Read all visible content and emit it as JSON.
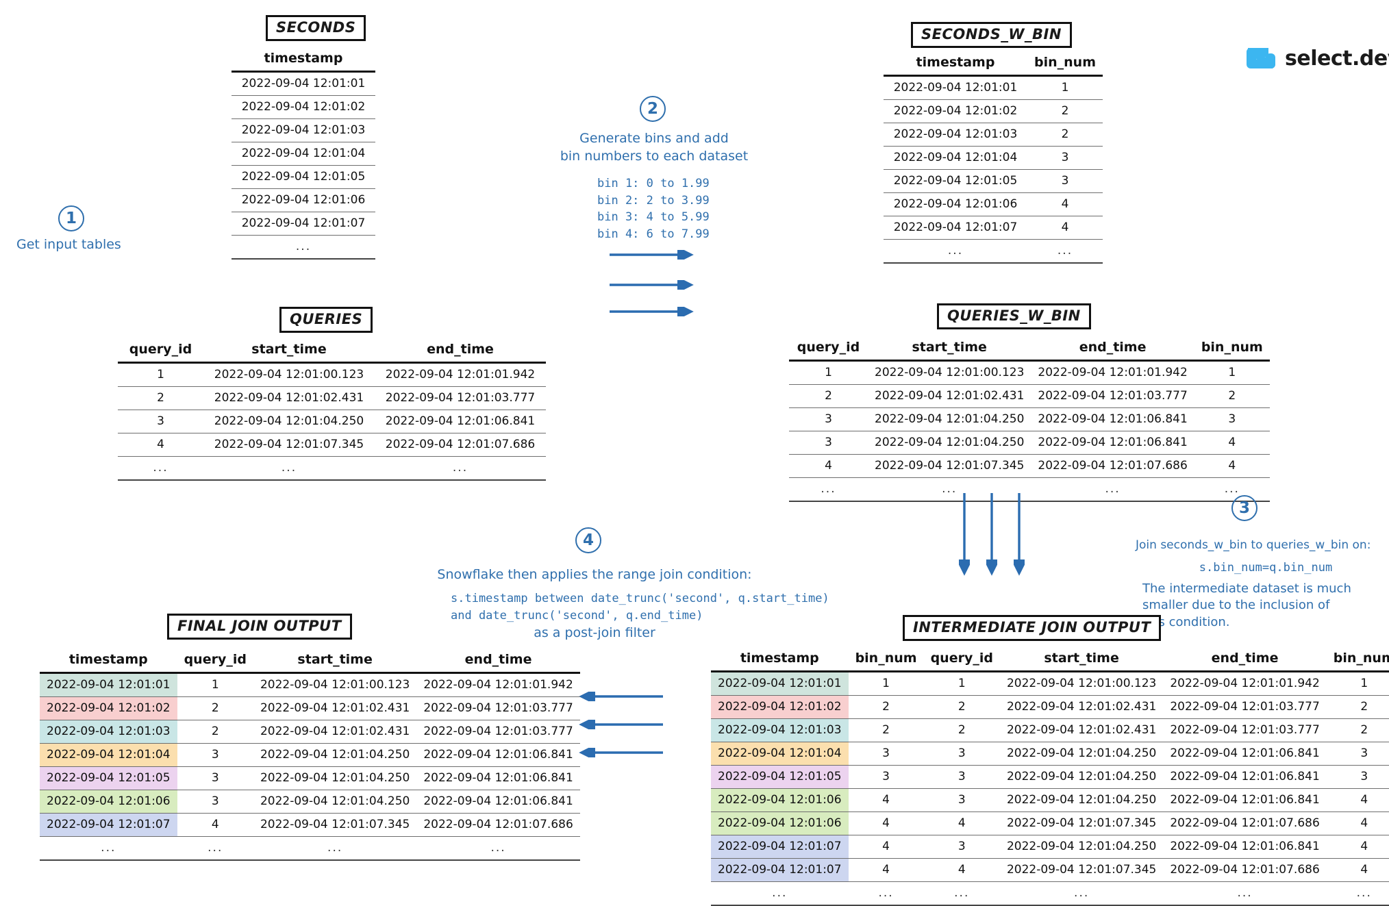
{
  "brand": {
    "name": "select.dev",
    "mark_color": "#3cb6f0",
    "icon": "select-logo-icon"
  },
  "accent_color": "#2f6fad",
  "steps": [
    {
      "number": "1",
      "title": "Get input tables"
    },
    {
      "number": "2",
      "title": "Generate bins and add\nbin numbers to each dataset",
      "code": "bin 1: 0 to 1.99\nbin 2: 2 to 3.99\nbin 3: 4 to 5.99\nbin 4: 6 to 7.99"
    },
    {
      "number": "3",
      "title": "Join seconds_w_bin to queries_w_bin on:",
      "code": "s.bin_num=q.bin_num",
      "note": "The intermediate dataset is much\nsmaller due to the inclusion of\nthis condition."
    },
    {
      "number": "4",
      "title": "Snowflake then applies the range join condition:",
      "code": "s.timestamp between date_trunc('second', q.start_time)\nand date_trunc('second', q.end_time)",
      "footer": "as a post-join filter"
    }
  ],
  "tables": {
    "seconds": {
      "title": "SECONDS",
      "columns": [
        "timestamp"
      ],
      "rows": [
        [
          "2022-09-04 12:01:01"
        ],
        [
          "2022-09-04 12:01:02"
        ],
        [
          "2022-09-04 12:01:03"
        ],
        [
          "2022-09-04 12:01:04"
        ],
        [
          "2022-09-04 12:01:05"
        ],
        [
          "2022-09-04 12:01:06"
        ],
        [
          "2022-09-04 12:01:07"
        ],
        [
          "..."
        ]
      ]
    },
    "seconds_w_bin": {
      "title": "SECONDS_W_BIN",
      "columns": [
        "timestamp",
        "bin_num"
      ],
      "rows": [
        [
          "2022-09-04 12:01:01",
          "1"
        ],
        [
          "2022-09-04 12:01:02",
          "2"
        ],
        [
          "2022-09-04 12:01:03",
          "2"
        ],
        [
          "2022-09-04 12:01:04",
          "3"
        ],
        [
          "2022-09-04 12:01:05",
          "3"
        ],
        [
          "2022-09-04 12:01:06",
          "4"
        ],
        [
          "2022-09-04 12:01:07",
          "4"
        ],
        [
          "...",
          "..."
        ]
      ]
    },
    "queries": {
      "title": "QUERIES",
      "columns": [
        "query_id",
        "start_time",
        "end_time"
      ],
      "rows": [
        [
          "1",
          "2022-09-04 12:01:00.123",
          "2022-09-04 12:01:01.942"
        ],
        [
          "2",
          "2022-09-04 12:01:02.431",
          "2022-09-04 12:01:03.777"
        ],
        [
          "3",
          "2022-09-04 12:01:04.250",
          "2022-09-04 12:01:06.841"
        ],
        [
          "4",
          "2022-09-04 12:01:07.345",
          "2022-09-04 12:01:07.686"
        ],
        [
          "...",
          "...",
          "..."
        ]
      ]
    },
    "queries_w_bin": {
      "title": "QUERIES_W_BIN",
      "columns": [
        "query_id",
        "start_time",
        "end_time",
        "bin_num"
      ],
      "rows": [
        [
          "1",
          "2022-09-04 12:01:00.123",
          "2022-09-04 12:01:01.942",
          "1"
        ],
        [
          "2",
          "2022-09-04 12:01:02.431",
          "2022-09-04 12:01:03.777",
          "2"
        ],
        [
          "3",
          "2022-09-04 12:01:04.250",
          "2022-09-04 12:01:06.841",
          "3"
        ],
        [
          "3",
          "2022-09-04 12:01:04.250",
          "2022-09-04 12:01:06.841",
          "4"
        ],
        [
          "4",
          "2022-09-04 12:01:07.345",
          "2022-09-04 12:01:07.686",
          "4"
        ],
        [
          "...",
          "...",
          "...",
          "..."
        ]
      ]
    },
    "intermediate_join_output": {
      "title": "INTERMEDIATE JOIN OUTPUT",
      "columns": [
        "timestamp",
        "bin_num",
        "query_id",
        "start_time",
        "end_time",
        "bin_num"
      ],
      "rows": [
        {
          "cells": [
            "2022-09-04 12:01:01",
            "1",
            "1",
            "2022-09-04 12:01:00.123",
            "2022-09-04 12:01:01.942",
            "1"
          ],
          "highlight": "#cfe4dd"
        },
        {
          "cells": [
            "2022-09-04 12:01:02",
            "2",
            "2",
            "2022-09-04 12:01:02.431",
            "2022-09-04 12:01:03.777",
            "2"
          ],
          "highlight": "#f8cfcf"
        },
        {
          "cells": [
            "2022-09-04 12:01:03",
            "2",
            "2",
            "2022-09-04 12:01:02.431",
            "2022-09-04 12:01:03.777",
            "2"
          ],
          "highlight": "#c9e6e6"
        },
        {
          "cells": [
            "2022-09-04 12:01:04",
            "3",
            "3",
            "2022-09-04 12:01:04.250",
            "2022-09-04 12:01:06.841",
            "3"
          ],
          "highlight": "#fbdfae"
        },
        {
          "cells": [
            "2022-09-04 12:01:05",
            "3",
            "3",
            "2022-09-04 12:01:04.250",
            "2022-09-04 12:01:06.841",
            "3"
          ],
          "highlight": "#ecd3ef"
        },
        {
          "cells": [
            "2022-09-04 12:01:06",
            "4",
            "3",
            "2022-09-04 12:01:04.250",
            "2022-09-04 12:01:06.841",
            "4"
          ],
          "highlight": "#d8ecbf"
        },
        {
          "cells": [
            "2022-09-04 12:01:06",
            "4",
            "4",
            "2022-09-04 12:01:07.345",
            "2022-09-04 12:01:07.686",
            "4"
          ],
          "highlight": "#d8ecbf"
        },
        {
          "cells": [
            "2022-09-04 12:01:07",
            "4",
            "3",
            "2022-09-04 12:01:04.250",
            "2022-09-04 12:01:06.841",
            "4"
          ],
          "highlight": "#cdd6f0"
        },
        {
          "cells": [
            "2022-09-04 12:01:07",
            "4",
            "4",
            "2022-09-04 12:01:07.345",
            "2022-09-04 12:01:07.686",
            "4"
          ],
          "highlight": "#cdd6f0"
        },
        {
          "cells": [
            "...",
            "...",
            "...",
            "...",
            "...",
            "..."
          ],
          "highlight": ""
        }
      ]
    },
    "final_join_output": {
      "title": "FINAL JOIN OUTPUT",
      "columns": [
        "timestamp",
        "query_id",
        "start_time",
        "end_time"
      ],
      "rows": [
        {
          "cells": [
            "2022-09-04 12:01:01",
            "1",
            "2022-09-04 12:01:00.123",
            "2022-09-04 12:01:01.942"
          ],
          "highlight": "#cfe4dd"
        },
        {
          "cells": [
            "2022-09-04 12:01:02",
            "2",
            "2022-09-04 12:01:02.431",
            "2022-09-04 12:01:03.777"
          ],
          "highlight": "#f8cfcf"
        },
        {
          "cells": [
            "2022-09-04 12:01:03",
            "2",
            "2022-09-04 12:01:02.431",
            "2022-09-04 12:01:03.777"
          ],
          "highlight": "#c9e6e6"
        },
        {
          "cells": [
            "2022-09-04 12:01:04",
            "3",
            "2022-09-04 12:01:04.250",
            "2022-09-04 12:01:06.841"
          ],
          "highlight": "#fbdfae"
        },
        {
          "cells": [
            "2022-09-04 12:01:05",
            "3",
            "2022-09-04 12:01:04.250",
            "2022-09-04 12:01:06.841"
          ],
          "highlight": "#ecd3ef"
        },
        {
          "cells": [
            "2022-09-04 12:01:06",
            "3",
            "2022-09-04 12:01:04.250",
            "2022-09-04 12:01:06.841"
          ],
          "highlight": "#d8ecbf"
        },
        {
          "cells": [
            "2022-09-04 12:01:07",
            "4",
            "2022-09-04 12:01:07.345",
            "2022-09-04 12:01:07.686"
          ],
          "highlight": "#cdd6f0"
        },
        {
          "cells": [
            "...",
            "...",
            "...",
            "..."
          ],
          "highlight": ""
        }
      ]
    }
  },
  "arrows": {
    "bins_right": {
      "count": 3,
      "direction": "right",
      "name": "arrow-right-binning"
    },
    "join_down": {
      "count": 3,
      "direction": "down",
      "name": "arrow-down-join"
    },
    "filter_left": {
      "count": 3,
      "direction": "left",
      "name": "arrow-left-filter"
    }
  }
}
